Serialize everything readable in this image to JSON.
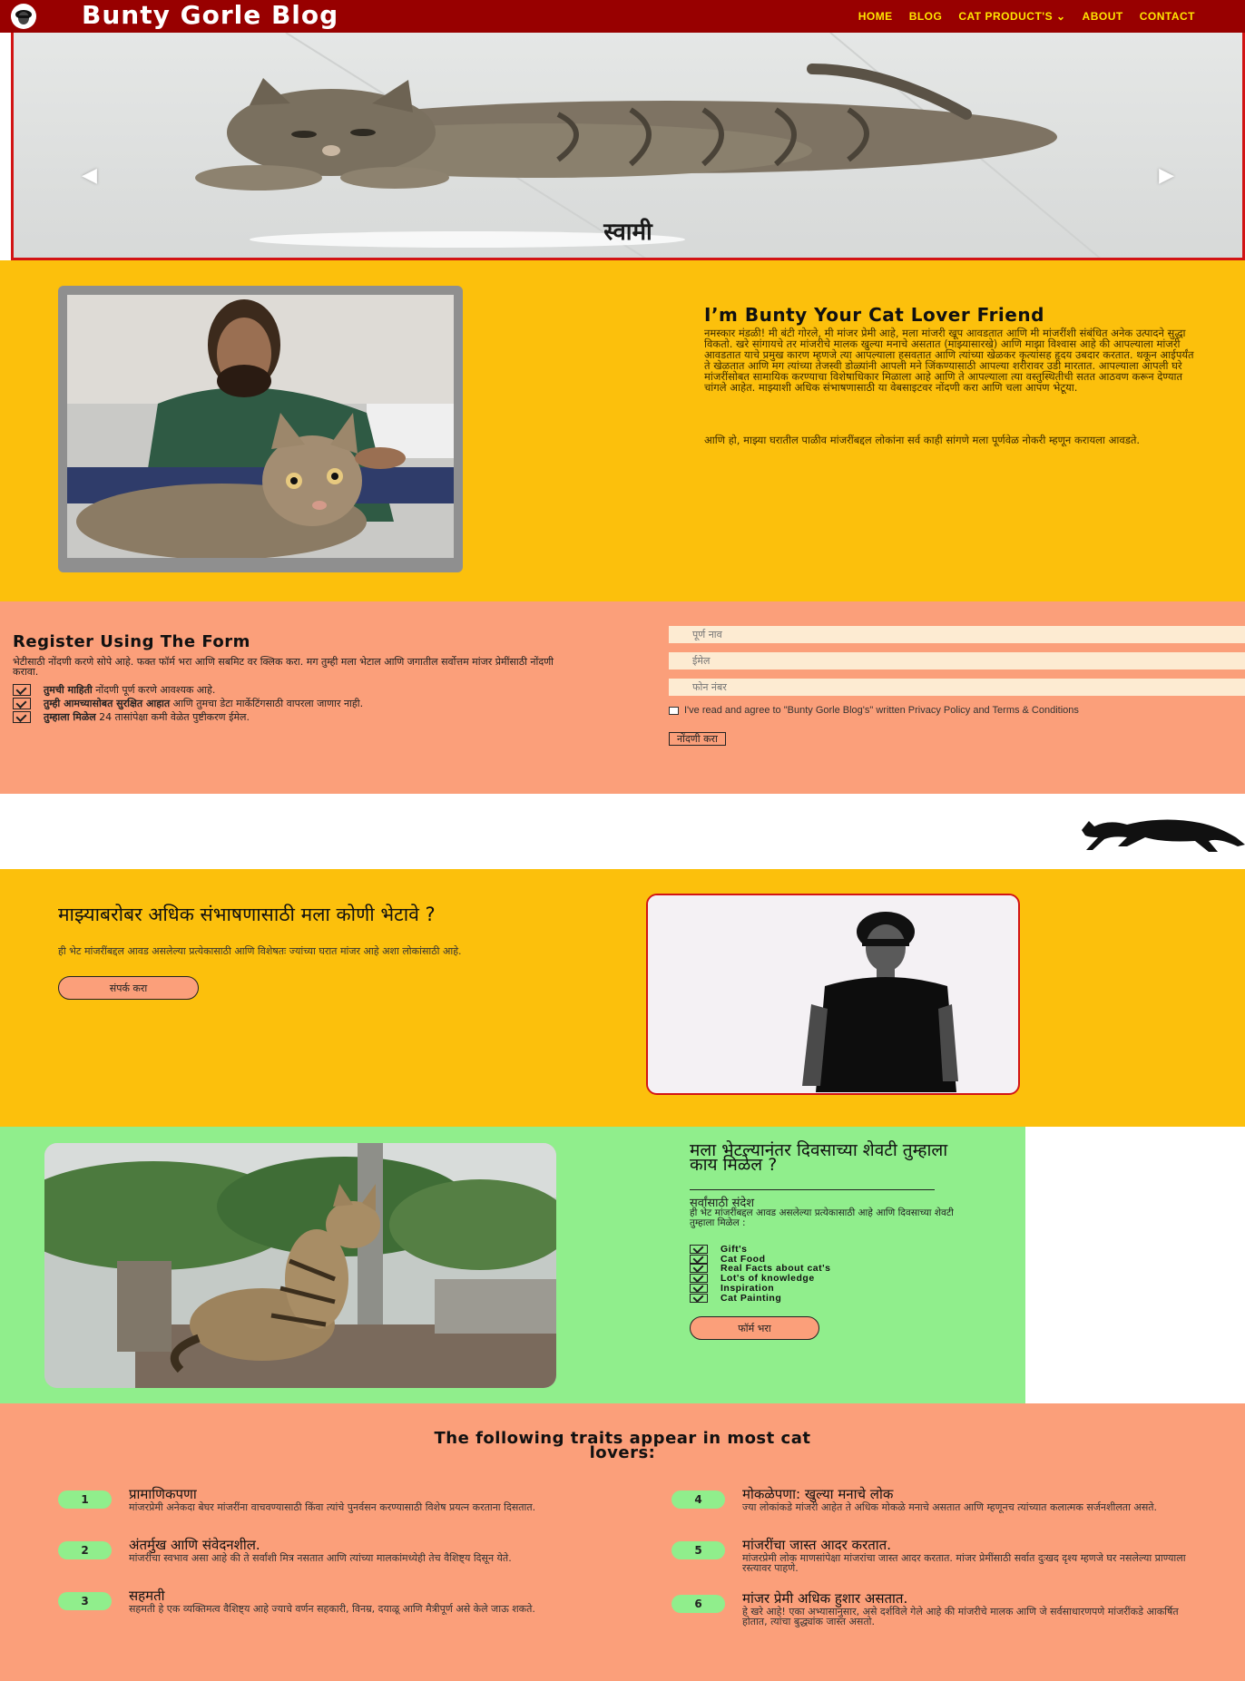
{
  "nav": {
    "brand": "Bunty Gorle Blog",
    "links": [
      "HOME",
      "BLOG",
      "CAT PRODUCT'S ⌄",
      "ABOUT",
      "CONTACT"
    ]
  },
  "hero": {
    "caption": "स्वामी",
    "prev_arrow": "◀",
    "next_arrow": "▶"
  },
  "about": {
    "title": "I’m Bunty Your Cat Lover Friend",
    "paragraph1": "नमस्कार मंडळी! मी बंटी गोरले, मी मांजर प्रेमी आहे, मला मांजरी खूप आवडतात आणि मी मांजरींशी संबंधित अनेक उत्पादने सुद्धा विकतो. खरे सांगायचे तर मांजरीचे मालक खुल्या मनाचे असतात (माझ्यासारखे) आणि माझा विश्वास आहे की आपल्याला मांजरी आवडतात याचे प्रमुख कारण म्हणजे त्या आपल्याला हसवतात आणि त्यांच्या खेळकर कृत्यांसह हृदय उबदार करतात. थकून आईपर्यंत ते खेळतात आणि मग त्यांच्या तेजस्वी डोळ्यांनी आपली मने जिंकण्यासाठी आपल्या शरीरावर उडी मारतात. आपल्याला आपली घरे मांजरींसोबत सामायिक करण्याचा विशेषाधिकार मिळाला आहे आणि ते आपल्याला त्या वस्तुस्थितीची सतत आठवण करून देण्यात चांगले आहेत. माझ्याशी अधिक संभाषणासाठी या वेबसाइटवर नोंदणी करा आणि चला आपण भेटूया.",
    "paragraph2": "आणि हो, माझ्या घरातील पाळीव मांजरींबद्दल लोकांना सर्व काही सांगणे मला पूर्णवेळ नोकरी म्हणून करायला आवडते."
  },
  "register": {
    "title": "Register Using The Form",
    "text": "भेटीसाठी नोंदणी करणे सोपे आहे. फक्त फॉर्म भरा आणि सबमिट वर क्लिक करा. मग तुम्ही मला भेटाल आणि जगातील सर्वोत्तम मांजर प्रेमींसाठी नोंदणी करावा.",
    "items": [
      {
        "bold": "तुमची माहिती",
        "rest": " नोंदणी पूर्ण करणे आवश्यक आहे."
      },
      {
        "bold": "तुम्ही आमच्यासोबत सुरक्षित आहात",
        "rest": " आणि तुमचा डेटा मार्केटिंगसाठी वापरला जाणार नाही."
      },
      {
        "bold": "तुम्हाला मिळेल",
        "rest": " 24 तासांपेक्षा कमी वेळेत पुष्टीकरण ईमेल."
      }
    ],
    "placeholders": {
      "name": "पूर्ण नाव",
      "email": "ईमेल",
      "phone": "फोन नंबर"
    },
    "terms": "I've read and agree to \"Bunty Gorle Blog's\" written Privacy Policy and Terms & Conditions",
    "submit": "नोंदणी करा"
  },
  "meet": {
    "title": "माझ्याबरोबर अधिक संभाषणासाठी मला कोणी भेटावे ?",
    "text": "ही भेट मांजरींबद्दल आवड असलेल्या प्रत्येकासाठी आणि विशेषतः ज्यांच्या घरात मांजर आहे अशा लोकांसाठी आहे.",
    "button": "संपर्क करा"
  },
  "benefits": {
    "title": "मला भेटल्यानंतर दिवसाच्या शेवटी तुम्हाला काय मिळेल ?",
    "subtitle": "सर्वांसाठी संदेश",
    "text": "ही भेट मांजरींबद्दल आवड असलेल्या प्रत्येकासाठी आहे आणि दिवसाच्या शेवटी तुम्हाला मिळेल :",
    "items": [
      "Gift's",
      "Cat Food",
      "Real Facts about cat's",
      "Lot's of knowledge",
      "Inspiration",
      "Cat Painting"
    ],
    "button": "फॉर्म भरा"
  },
  "traits": {
    "title_line1": "The following traits appear in most cat",
    "title_line2": "lovers:",
    "items": [
      {
        "num": "1",
        "head": "प्रामाणिकपणा",
        "body": "मांजरप्रेमी अनेकदा बेघर मांजरींना वाचवण्यासाठी किंवा त्यांचे पुनर्वसन करण्यासाठी विशेष प्रयत्न करताना दिसतात."
      },
      {
        "num": "2",
        "head": "अंतर्मुख आणि संवेदनशील.",
        "body": "मांजरींचा स्वभाव असा आहे की ते सर्वांशी मित्र नसतात आणि त्यांच्या मालकांमध्येही तेच वैशिष्ट्य दिसून येते."
      },
      {
        "num": "3",
        "head": "सहमती",
        "body": "सहमती हे एक व्यक्तिमत्व वैशिष्ट्य आहे ज्याचे वर्णन सहकारी, विनम्र, दयाळू आणि मैत्रीपूर्ण असे केले जाऊ शकते."
      },
      {
        "num": "4",
        "head": "मोकळेपणा: खुल्या मनाचे लोक",
        "body": "ज्या लोकांकडे मांजरी आहेत ते अधिक मोकळे मनाचे असतात आणि म्हणूनच त्यांच्यात कलात्मक सर्जनशीलता असते."
      },
      {
        "num": "5",
        "head": "मांजरींचा जास्त आदर करतात.",
        "body": "मांजरप्रेमी लोक माणसांपेक्षा मांजरांचा जास्त आदर करतात. मांजर प्रेमींसाठी सर्वात दुःखद दृश्य म्हणजे घर नसलेल्या प्राण्याला रस्त्यावर पाहणे."
      },
      {
        "num": "6",
        "head": "मांजर प्रेमी अधिक हुशार असतात.",
        "body": "हे खरे आहे! एका अभ्यासानुसार, असे दर्शविले गेले आहे की मांजरीचे मालक आणि जे सर्वसाधारणपणे मांजरींकडे आकर्षित होतात, त्यांचा बुद्ध्यांक जास्त असतो."
      }
    ]
  },
  "colors": {
    "nav_bg": "#980000",
    "nav_link": "#ffe600",
    "yellow": "#fcc00c",
    "salmon": "#fb9f7a",
    "green": "#90ee8c",
    "red_border": "#d21414"
  }
}
